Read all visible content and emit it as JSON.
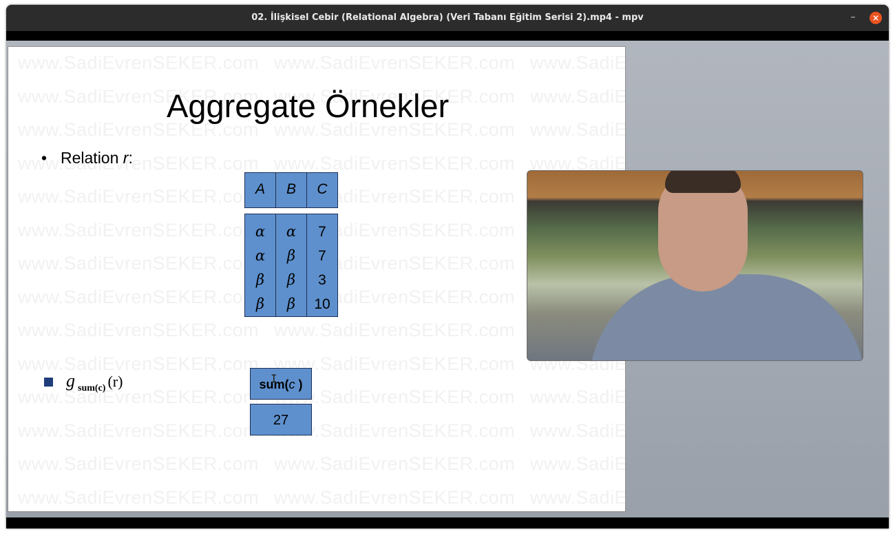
{
  "window": {
    "title": "02. İlişkisel Cebir (Relational Algebra) (Veri Tabanı Eğitim Serisi 2).mp4 - mpv",
    "minimize_label": "–",
    "close_label": "×",
    "close_color": "#e95420"
  },
  "slide": {
    "watermark": "www.SadiEvrenSEKER.com",
    "title": "Aggregate Örnekler",
    "bullet_symbol": "•",
    "bullet_text": "Relation ",
    "bullet_var": "r",
    "bullet_colon": ":",
    "relation": {
      "headers": [
        "A",
        "B",
        "C"
      ],
      "columns": [
        [
          "α",
          "α",
          "β",
          "β"
        ],
        [
          "α",
          "β",
          "β",
          "β"
        ],
        [
          "7",
          "7",
          "3",
          "10"
        ]
      ]
    },
    "aggregate_expr": {
      "letter": "g",
      "subscript": "sum(c)",
      "argument": "(r)"
    },
    "result": {
      "header_prefix": "sum(",
      "header_var": "c",
      "header_suffix": " )",
      "value": "27"
    },
    "cell_color": "#5e90cd"
  },
  "webcam": {
    "icon": "presenter-webcam"
  }
}
